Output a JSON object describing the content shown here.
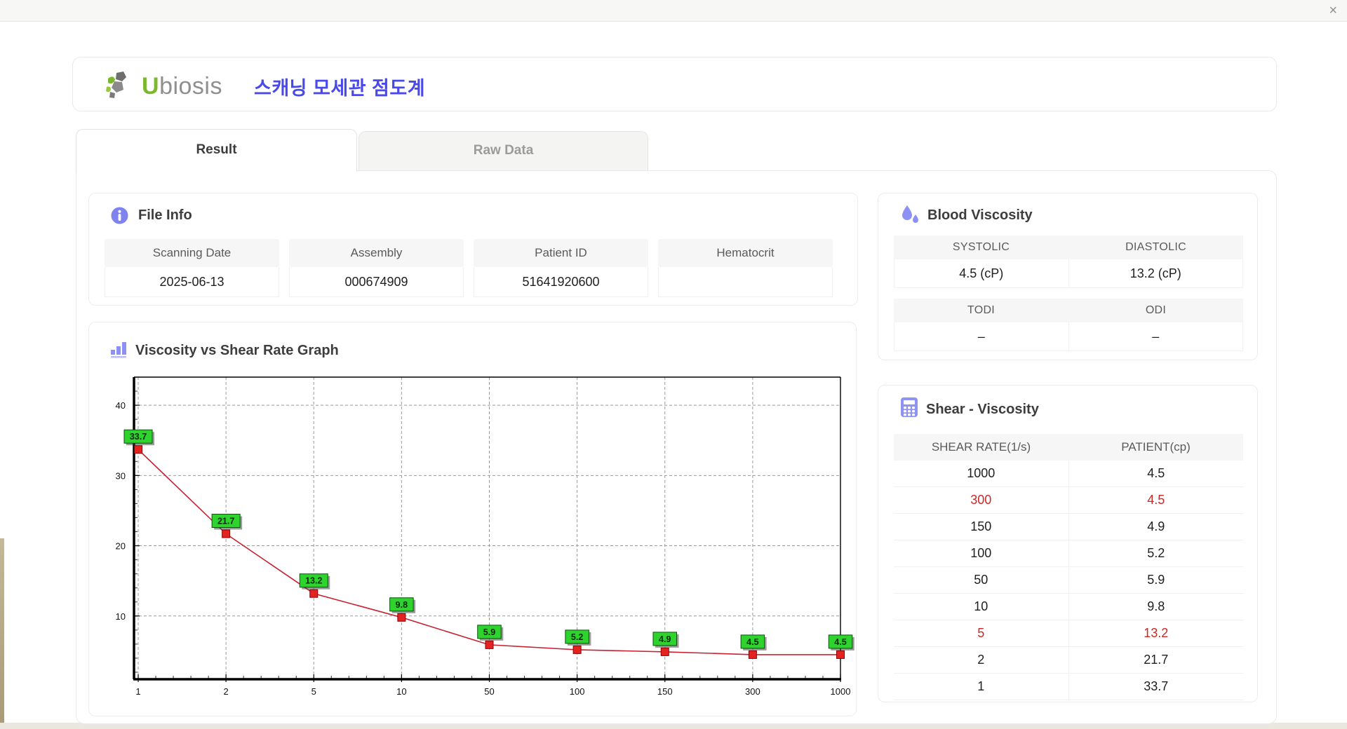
{
  "titlebar": {
    "close_icon": "×"
  },
  "header": {
    "logo_u": "U",
    "logo_rest": "biosis",
    "app_title": "스캐닝 모세관 점도계"
  },
  "tabs": [
    {
      "label": "Result",
      "active": true
    },
    {
      "label": "Raw Data",
      "active": false
    }
  ],
  "file_info": {
    "title": "File Info",
    "fields": [
      {
        "label": "Scanning Date",
        "value": "2025-06-13"
      },
      {
        "label": "Assembly",
        "value": "000674909"
      },
      {
        "label": "Patient ID",
        "value": "51641920600"
      },
      {
        "label": "Hematocrit",
        "value": ""
      }
    ]
  },
  "blood_viscosity": {
    "title": "Blood Viscosity",
    "tables": [
      {
        "headers": [
          "SYSTOLIC",
          "DIASTOLIC"
        ],
        "values": [
          "4.5 (cP)",
          "13.2 (cP)"
        ]
      },
      {
        "headers": [
          "TODI",
          "ODI"
        ],
        "values": [
          "–",
          "–"
        ]
      }
    ]
  },
  "chart_data": {
    "type": "line",
    "title": "Viscosity vs Shear Rate Graph",
    "categories": [
      "1",
      "2",
      "5",
      "10",
      "50",
      "100",
      "150",
      "300",
      "1000"
    ],
    "values": [
      33.7,
      21.7,
      13.2,
      9.8,
      5.9,
      5.2,
      4.9,
      4.5,
      4.5
    ],
    "point_labels": [
      "33.7",
      "21.7",
      "13.2",
      "9.8",
      "5.9",
      "5.2",
      "4.9",
      "4.5",
      "4.5"
    ],
    "xlabel": "",
    "ylabel": "",
    "yticks": [
      10,
      20,
      30,
      40
    ],
    "ylim": [
      1,
      44
    ],
    "grid": true,
    "legend": "none",
    "line_color": "#c92233",
    "marker_color": "#e32222",
    "marker_border": "#8f0000",
    "label_bg": "#2ed32e",
    "label_border": "#0a500a",
    "grid_color": "#9a9a9a"
  },
  "shear_viscosity": {
    "title": "Shear - Viscosity",
    "columns": [
      "SHEAR RATE(1/s)",
      "PATIENT(cp)"
    ],
    "highlight_color": "#cc2626",
    "rows": [
      {
        "shear_rate": "1000",
        "patient": "4.5",
        "highlight": false
      },
      {
        "shear_rate": "300",
        "patient": "4.5",
        "highlight": true
      },
      {
        "shear_rate": "150",
        "patient": "4.9",
        "highlight": false
      },
      {
        "shear_rate": "100",
        "patient": "5.2",
        "highlight": false
      },
      {
        "shear_rate": "50",
        "patient": "5.9",
        "highlight": false
      },
      {
        "shear_rate": "10",
        "patient": "9.8",
        "highlight": false
      },
      {
        "shear_rate": "5",
        "patient": "13.2",
        "highlight": true
      },
      {
        "shear_rate": "2",
        "patient": "21.7",
        "highlight": false
      },
      {
        "shear_rate": "1",
        "patient": "33.7",
        "highlight": false
      }
    ]
  }
}
